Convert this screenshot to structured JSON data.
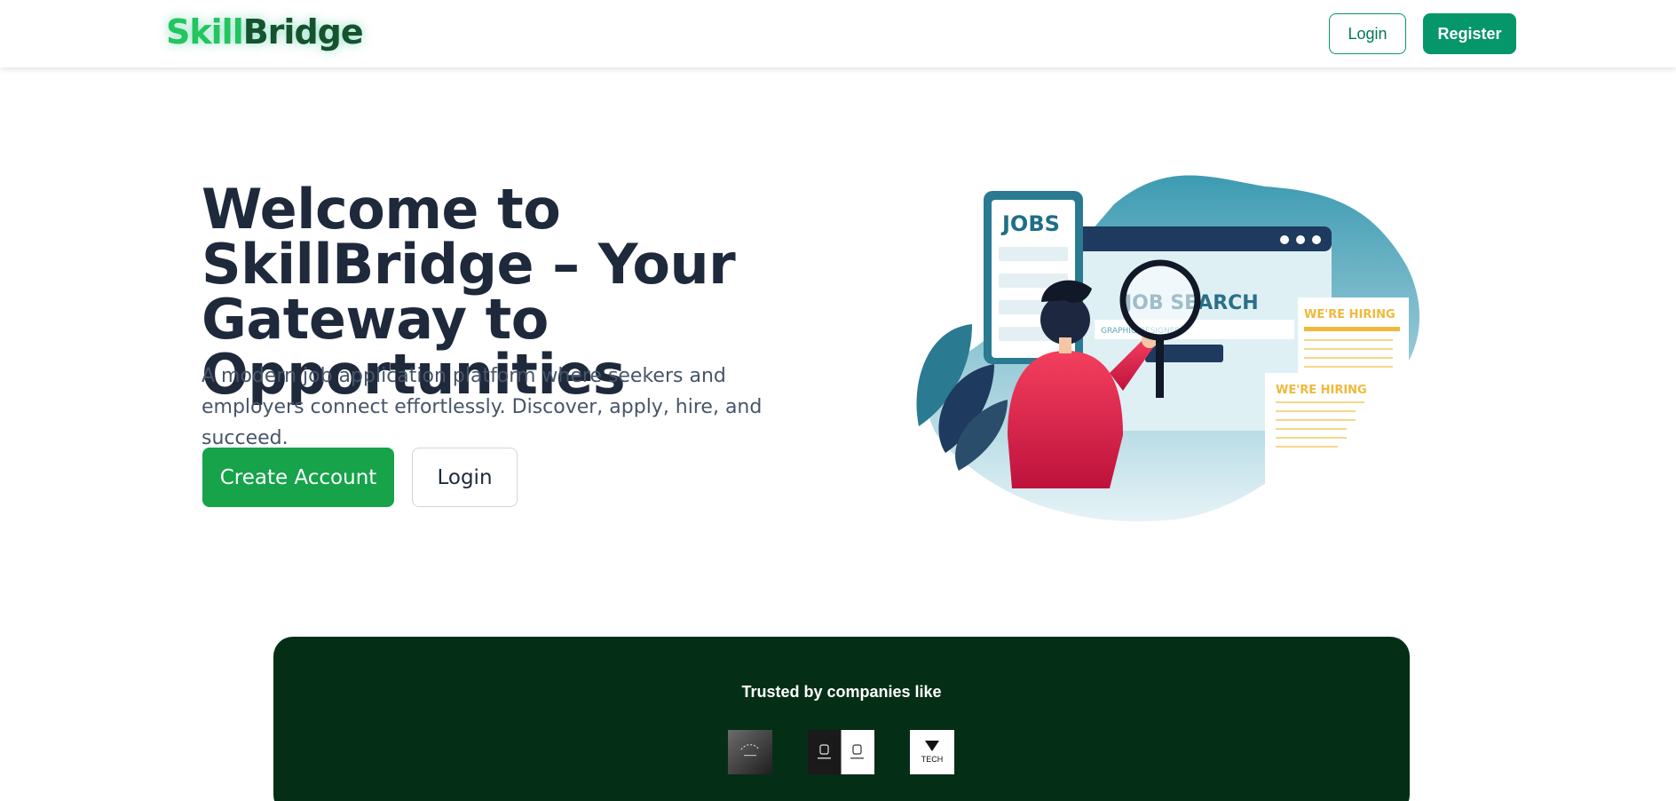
{
  "brand": {
    "part1": "Skill",
    "part2": "Bridge"
  },
  "nav": {
    "login_label": "Login",
    "register_label": "Register"
  },
  "hero": {
    "title": "Welcome to SkillBridge – Your Gateway to Opportunities",
    "subtitle": "A modern job application platform where seekers and employers connect effortlessly. Discover, apply, hire, and succeed.",
    "create_account_label": "Create Account",
    "login_label": "Login"
  },
  "illustration": {
    "jobs_text": "JOBS",
    "job_search_text": "JOB SEARCH",
    "search_field_text": "GRAPHIC DESIGNER",
    "hiring_text_1": "WE'RE HIRING",
    "hiring_text_2": "WE'RE HIRING"
  },
  "trusted": {
    "title": "Trusted by companies like",
    "logo3_text": "TECH"
  },
  "colors": {
    "primary": "#059669",
    "cta": "#16a34a",
    "dark_green": "#052e16",
    "heading": "#1e293b"
  }
}
